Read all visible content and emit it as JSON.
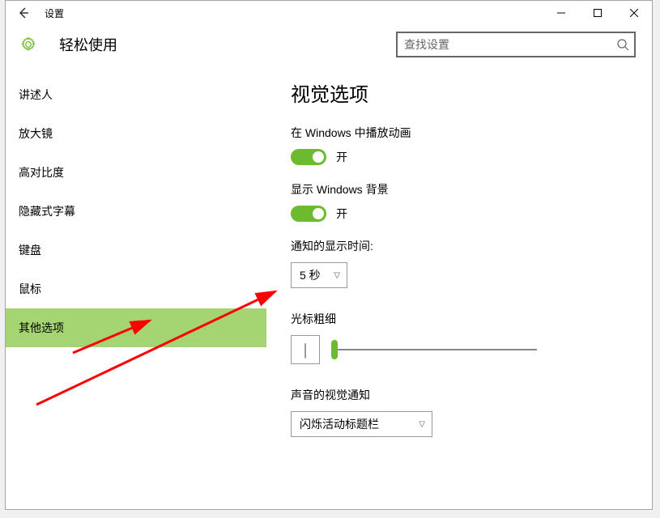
{
  "titlebar": {
    "label": "设置"
  },
  "header": {
    "app_title": "轻松使用"
  },
  "search": {
    "placeholder": "查找设置"
  },
  "sidebar": {
    "items": [
      {
        "label": "讲述人"
      },
      {
        "label": "放大镜"
      },
      {
        "label": "高对比度"
      },
      {
        "label": "隐藏式字幕"
      },
      {
        "label": "键盘"
      },
      {
        "label": "鼠标"
      },
      {
        "label": "其他选项"
      }
    ],
    "active_index": 6
  },
  "main": {
    "heading": "视觉选项",
    "animate": {
      "label": "在 Windows 中播放动画",
      "status": "开",
      "on": true
    },
    "background": {
      "label": "显示 Windows 背景",
      "status": "开",
      "on": true
    },
    "notify_time": {
      "label": "通知的显示时间:",
      "value": "5 秒"
    },
    "cursor": {
      "label": "光标粗细",
      "preview": "|"
    },
    "sound_visual": {
      "label": "声音的视觉通知",
      "value": "闪烁活动标题栏"
    }
  }
}
